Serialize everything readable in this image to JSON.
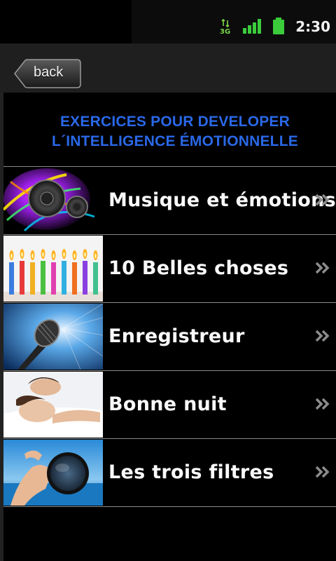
{
  "status_bar": {
    "network": "3G",
    "time": "2:30",
    "signal_color": "#3bcc3b",
    "battery_color": "#3bcc3b"
  },
  "nav": {
    "back_label": "back"
  },
  "page": {
    "title_line1": "EXERCICES POUR DEVELOPER",
    "title_line2": "L´INTELLIGENCE ÉMOTIONNELLE",
    "title_color": "#2a68e8"
  },
  "menu": {
    "items": [
      {
        "label": "Musique et émotions",
        "thumb": "speaker-image",
        "chevron": "double-chevron-right-icon"
      },
      {
        "label": "10 Belles choses",
        "thumb": "birthday-candles-image",
        "chevron": "double-chevron-right-icon"
      },
      {
        "label": "Enregistreur",
        "thumb": "microphone-image",
        "chevron": "double-chevron-right-icon"
      },
      {
        "label": "Bonne nuit",
        "thumb": "sleeping-couple-image",
        "chevron": "double-chevron-right-icon"
      },
      {
        "label": "Les trois filtres",
        "thumb": "hand-filter-lens-image",
        "chevron": "double-chevron-right-icon"
      }
    ]
  }
}
